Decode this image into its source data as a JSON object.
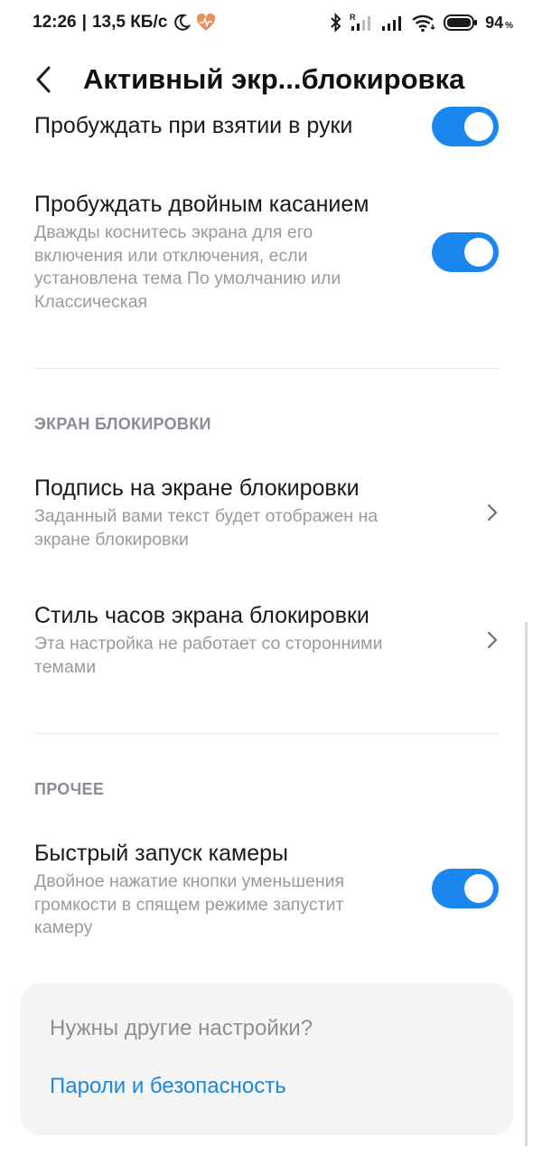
{
  "status_bar": {
    "time": "12:26",
    "separator": "|",
    "speed": "13,5 КБ/с",
    "battery_level": "94",
    "battery_unit": "%"
  },
  "header": {
    "title": "Активный экр...блокировка"
  },
  "settings": {
    "lift_to_wake": {
      "title": "Пробуждать при взятии в руки",
      "enabled": true
    },
    "double_tap_wake": {
      "title": "Пробуждать двойным касанием",
      "subtitle_lines": [
        "Дважды коснитесь экрана для его",
        "включения или отключения, если",
        "установлена тема По умолчанию или",
        "Классическая"
      ],
      "enabled": true
    }
  },
  "lock_screen_section": {
    "header": "ЭКРАН БЛОКИРОВКИ",
    "signature": {
      "title": "Подпись на экране блокировки",
      "subtitle_lines": [
        "Заданный вами текст будет отображен на",
        "экране блокировки"
      ]
    },
    "clock_style": {
      "title": "Стиль часов экрана блокировки",
      "subtitle_lines": [
        "Эта настройка не работает со сторонними",
        "темами"
      ]
    }
  },
  "other_section": {
    "header": "ПРОЧЕЕ",
    "quick_camera": {
      "title": "Быстрый запуск камеры",
      "subtitle_lines": [
        "Двойное нажатие кнопки уменьшения",
        "громкости в спящем режиме запустит",
        "камеру"
      ],
      "enabled": true
    }
  },
  "more_card": {
    "question": "Нужны другие настройки?",
    "link": "Пароли и безопасность"
  },
  "colors": {
    "accent": "#1a87f0",
    "link": "#1a87e0",
    "secondary_text": "#9a9a9a",
    "section_header": "#8a8d97",
    "heart_icon": "#e8915a"
  }
}
